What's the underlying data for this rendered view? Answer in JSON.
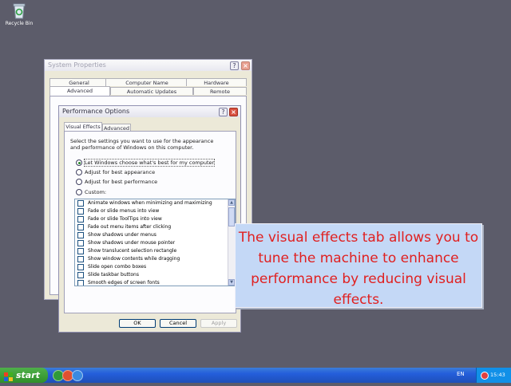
{
  "desktop": {
    "recycle_label": "Recycle Bin"
  },
  "system_properties": {
    "title": "System Properties",
    "tabs_row1": [
      "General",
      "Computer Name",
      "Hardware"
    ],
    "tabs_row2": [
      "Advanced",
      "Automatic Updates",
      "Remote"
    ],
    "active_tab": "Advanced"
  },
  "performance": {
    "title": "Performance Options",
    "tabs": [
      "Visual Effects",
      "Advanced"
    ],
    "active_tab": "Visual Effects",
    "description": "Select the settings you want to use for the appearance and performance of Windows on this computer.",
    "options": [
      {
        "label": "Let Windows choose what's best for my computer",
        "selected": true
      },
      {
        "label": "Adjust for best appearance",
        "selected": false
      },
      {
        "label": "Adjust for best performance",
        "selected": false
      },
      {
        "label": "Custom:",
        "selected": false
      }
    ],
    "effects": [
      "Animate windows when minimizing and maximizing",
      "Fade or slide menus into view",
      "Fade or slide ToolTips into view",
      "Fade out menu items after clicking",
      "Show shadows under menus",
      "Show shadows under mouse pointer",
      "Show translucent selection rectangle",
      "Show window contents while dragging",
      "Slide open combo boxes",
      "Slide taskbar buttons",
      "Smooth edges of screen fonts"
    ],
    "buttons": {
      "ok": "OK",
      "cancel": "Cancel",
      "apply": "Apply"
    }
  },
  "callout": {
    "text": "The visual effects tab allows you to tune the machine to enhance performance by reducing visual effects."
  },
  "taskbar": {
    "start_label": "start",
    "language": "EN",
    "clock": "15:43"
  },
  "colors": {
    "callout_text": "#e02020",
    "callout_bg": "#c4d8f6",
    "desktop": "#5c5c6a",
    "taskbar": "#245edb",
    "start": "#3c9e36"
  }
}
